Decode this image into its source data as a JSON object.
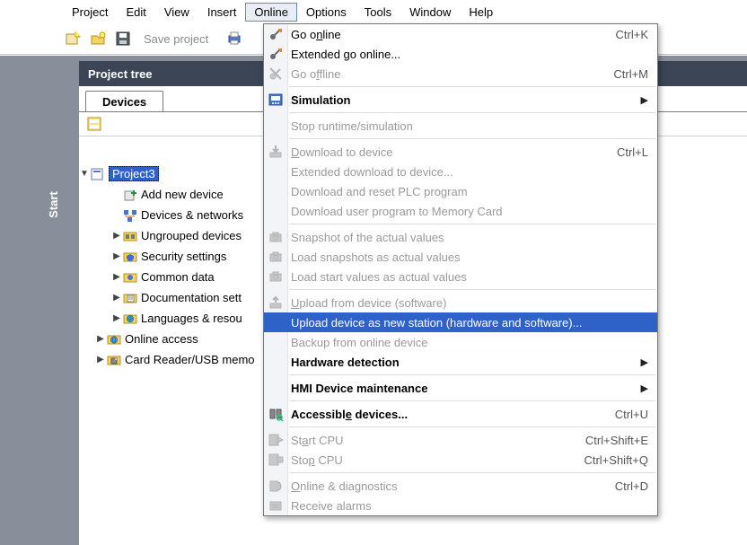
{
  "menubar": [
    "Project",
    "Edit",
    "View",
    "Insert",
    "Online",
    "Options",
    "Tools",
    "Window",
    "Help"
  ],
  "menubar_open_index": 4,
  "toolbar": {
    "save_label": "Save project"
  },
  "sidebar": {
    "title": "Project tree",
    "tab_label": "Devices",
    "start_label": "Start"
  },
  "tree": {
    "project_name": "Project3",
    "items": [
      {
        "label": "Add new device",
        "icon": "add-device-icon",
        "indent": 2,
        "tw": ""
      },
      {
        "label": "Devices & networks",
        "icon": "devices-networks-icon",
        "indent": 2,
        "tw": ""
      },
      {
        "label": "Ungrouped devices",
        "icon": "ungrouped-icon",
        "indent": 2,
        "tw": "▶"
      },
      {
        "label": "Security settings",
        "icon": "security-icon",
        "indent": 2,
        "tw": "▶"
      },
      {
        "label": "Common data",
        "icon": "common-data-icon",
        "indent": 2,
        "tw": "▶"
      },
      {
        "label": "Documentation settings",
        "icon": "documentation-icon",
        "indent": 2,
        "tw": "▶",
        "clip": "Documentation sett"
      },
      {
        "label": "Languages & resources",
        "icon": "languages-icon",
        "indent": 2,
        "tw": "▶",
        "clip": "Languages & resou"
      },
      {
        "label": "Online access",
        "icon": "online-access-icon",
        "indent": 1,
        "tw": "▶"
      },
      {
        "label": "Card Reader/USB memory",
        "icon": "card-reader-icon",
        "indent": 1,
        "tw": "▶",
        "clip": "Card Reader/USB memo"
      }
    ]
  },
  "menu": [
    {
      "type": "item",
      "label_html": "Go o<u>n</u>line",
      "shortcut": "Ctrl+K",
      "icon": "go-online-icon"
    },
    {
      "type": "item",
      "label_html": "Extended go online...",
      "icon": "go-online-ext-icon"
    },
    {
      "type": "item",
      "label_html": "Go o<u>f</u>fline",
      "shortcut": "Ctrl+M",
      "icon": "go-offline-icon",
      "disabled": true
    },
    {
      "type": "sep"
    },
    {
      "type": "item",
      "label_html": "Simulation",
      "bold": true,
      "submenu": true,
      "icon": "simulation-icon"
    },
    {
      "type": "sep"
    },
    {
      "type": "item",
      "label_html": "Stop runtime/simulation",
      "disabled": true
    },
    {
      "type": "sep"
    },
    {
      "type": "item",
      "label_html": "<u>D</u>ownload to device",
      "shortcut": "Ctrl+L",
      "icon": "download-icon",
      "disabled": true
    },
    {
      "type": "item",
      "label_html": "Extended download to device...",
      "disabled": true
    },
    {
      "type": "item",
      "label_html": "Download and reset PLC program",
      "disabled": true
    },
    {
      "type": "item",
      "label_html": "Download user program to Memory Card",
      "disabled": true
    },
    {
      "type": "sep"
    },
    {
      "type": "item",
      "label_html": "Snapshot of the actual values",
      "icon": "snapshot-icon",
      "disabled": true
    },
    {
      "type": "item",
      "label_html": "Load snapshots as actual values",
      "icon": "load-snapshot-icon",
      "disabled": true
    },
    {
      "type": "item",
      "label_html": "Load start values as actual values",
      "icon": "load-start-icon",
      "disabled": true
    },
    {
      "type": "sep"
    },
    {
      "type": "item",
      "label_html": "<u>U</u>pload from device (software)",
      "icon": "upload-icon",
      "disabled": true
    },
    {
      "type": "item",
      "label_html": "Upload device as new station (hardware and software)...",
      "hover": true
    },
    {
      "type": "item",
      "label_html": "Backup from online device",
      "disabled": true
    },
    {
      "type": "item",
      "label_html": "Hardware detection",
      "bold": true,
      "submenu": true
    },
    {
      "type": "sep"
    },
    {
      "type": "item",
      "label_html": "HMI Device maintenance",
      "bold": true,
      "submenu": true
    },
    {
      "type": "sep"
    },
    {
      "type": "item",
      "label_html": "Accessibl<u>e</u> devices...",
      "bold": true,
      "shortcut": "Ctrl+U",
      "icon": "accessible-icon"
    },
    {
      "type": "sep"
    },
    {
      "type": "item",
      "label_html": "St<u>a</u>rt CPU",
      "shortcut": "Ctrl+Shift+E",
      "icon": "start-cpu-icon",
      "disabled": true
    },
    {
      "type": "item",
      "label_html": "Sto<u>p</u> CPU",
      "shortcut": "Ctrl+Shift+Q",
      "icon": "stop-cpu-icon",
      "disabled": true
    },
    {
      "type": "sep"
    },
    {
      "type": "item",
      "label_html": "<u>O</u>nline & diagnostics",
      "shortcut": "Ctrl+D",
      "icon": "diagnostics-icon",
      "disabled": true
    },
    {
      "type": "item",
      "label_html": "Receive alarms",
      "icon": "alarms-icon",
      "disabled": true
    }
  ]
}
